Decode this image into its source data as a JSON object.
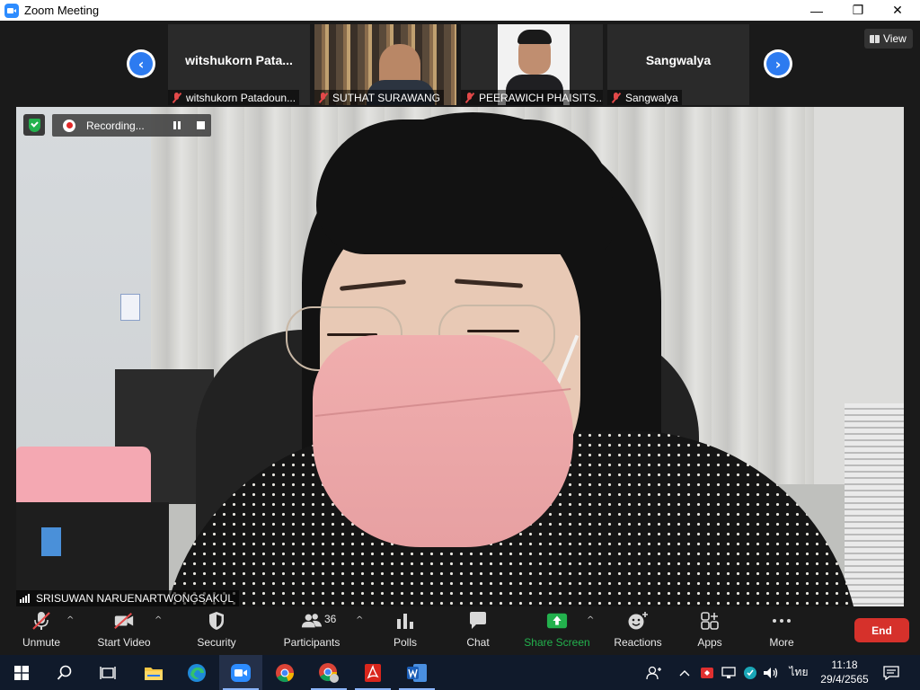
{
  "window": {
    "title": "Zoom Meeting",
    "minimize": "—",
    "restore": "❐",
    "close": "✕"
  },
  "gallery": {
    "prev": "‹",
    "next": "›",
    "view_label": "View",
    "tiles": [
      {
        "big_name": "witshukorn  Pata...",
        "label": "witshukorn Patadoun...",
        "video": false
      },
      {
        "big_name": "",
        "label": "SUTHAT SURAWANG",
        "video": true
      },
      {
        "big_name": "",
        "label": "PEERAWICH PHAISITS...",
        "video": true
      },
      {
        "big_name": "Sangwalya",
        "label": "Sangwalya",
        "video": false
      }
    ]
  },
  "recording": {
    "label": "Recording..."
  },
  "speaker": {
    "name": "SRISUWAN NARUENARTWONGSAKUL"
  },
  "toolbar": {
    "unmute": "Unmute",
    "start_video": "Start Video",
    "security": "Security",
    "participants": "Participants",
    "participants_count": "36",
    "polls": "Polls",
    "chat": "Chat",
    "share_screen": "Share Screen",
    "reactions": "Reactions",
    "apps": "Apps",
    "more": "More",
    "end": "End",
    "caret": "^"
  },
  "colors": {
    "share_green": "#23b14d",
    "end_red": "#d6312b",
    "accent_blue": "#2d8cff",
    "muted_red": "#e24949"
  },
  "taskbar": {
    "apps": [
      "windows-start",
      "search",
      "task-view",
      "file-explorer",
      "edge",
      "zoom",
      "chrome",
      "chrome-profile",
      "acrobat",
      "word"
    ],
    "language": "ไทย",
    "time": "11:18",
    "date": "29/4/2565"
  }
}
